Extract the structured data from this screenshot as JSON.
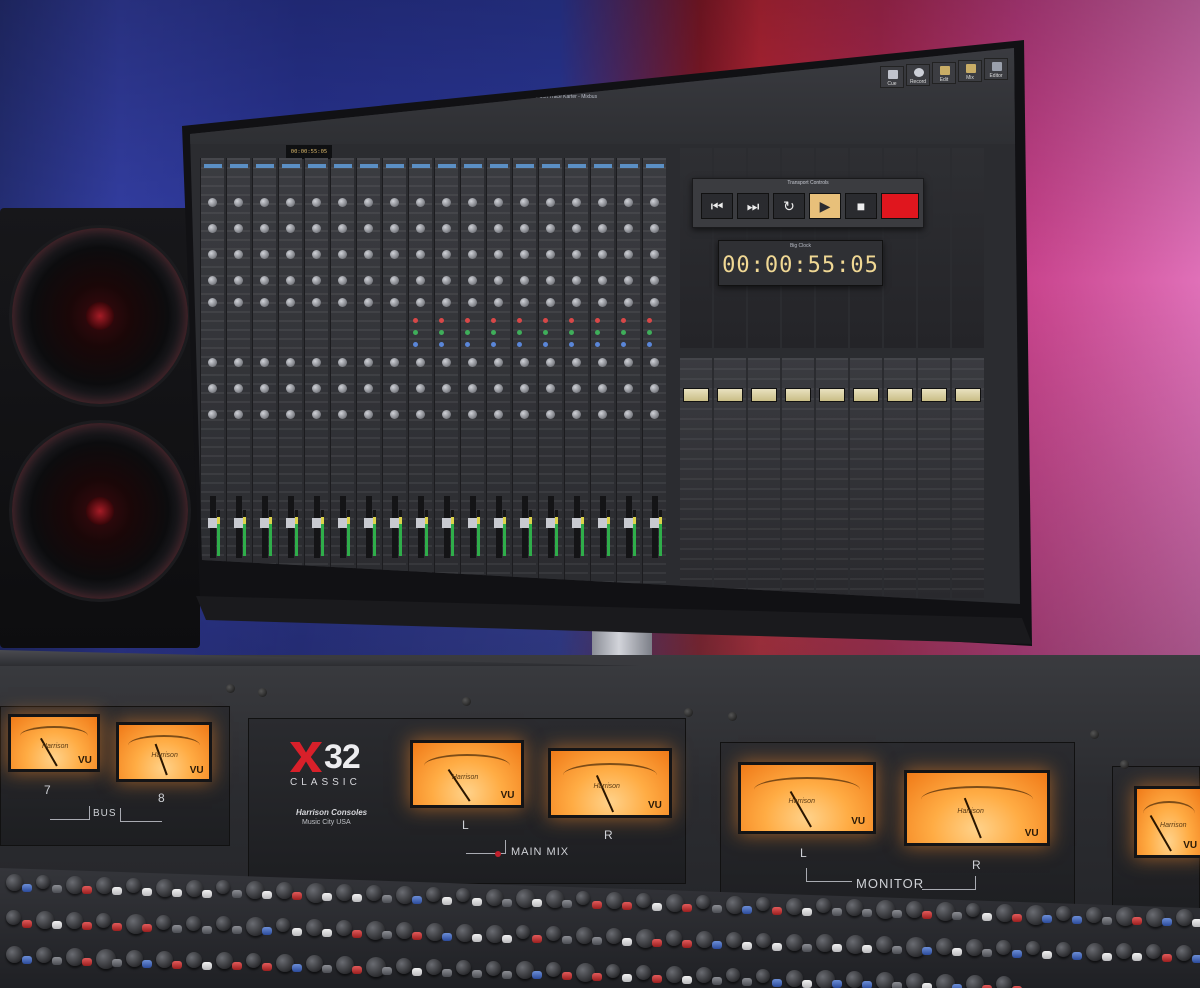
{
  "software": {
    "window_title": "\"Gimme Sim Trace Karter - Mixbus",
    "timecode_small": "00:00:55:05",
    "toolbar": [
      {
        "label": "Cue",
        "kind": "cue"
      },
      {
        "label": "Record",
        "kind": "rec"
      },
      {
        "label": "Edit",
        "kind": "edit"
      },
      {
        "label": "Mix",
        "kind": "mix"
      },
      {
        "label": "Editor",
        "kind": "editor"
      }
    ],
    "transport": {
      "title": "Transport Controls",
      "buttons": [
        {
          "name": "go-to-start",
          "glyph": "⏮"
        },
        {
          "name": "go-to-end",
          "glyph": "⏭"
        },
        {
          "name": "loop",
          "glyph": "↻"
        },
        {
          "name": "play",
          "glyph": "▶"
        },
        {
          "name": "stop",
          "glyph": "■"
        },
        {
          "name": "record",
          "glyph": ""
        }
      ]
    },
    "big_clock": {
      "label": "Big Clock",
      "time": "00:00:55:05"
    }
  },
  "console": {
    "model_number": "32",
    "model_name": "CLASSIC",
    "maker": "Harrison Consoles",
    "location": "Music City USA",
    "meter_text": "VU",
    "meter_brand": "Harrison",
    "bus_labels": {
      "left_num": "7",
      "right_num": "8",
      "name": "BUS"
    },
    "main_mix": {
      "left": "L",
      "right": "R",
      "name": "MAIN MIX"
    },
    "monitor": {
      "left": "L",
      "right": "R",
      "name": "MONITOR"
    }
  },
  "colors": {
    "accent_red": "#d8202a",
    "meter_amber": "#ffac44",
    "clock_text": "#f0d894"
  }
}
